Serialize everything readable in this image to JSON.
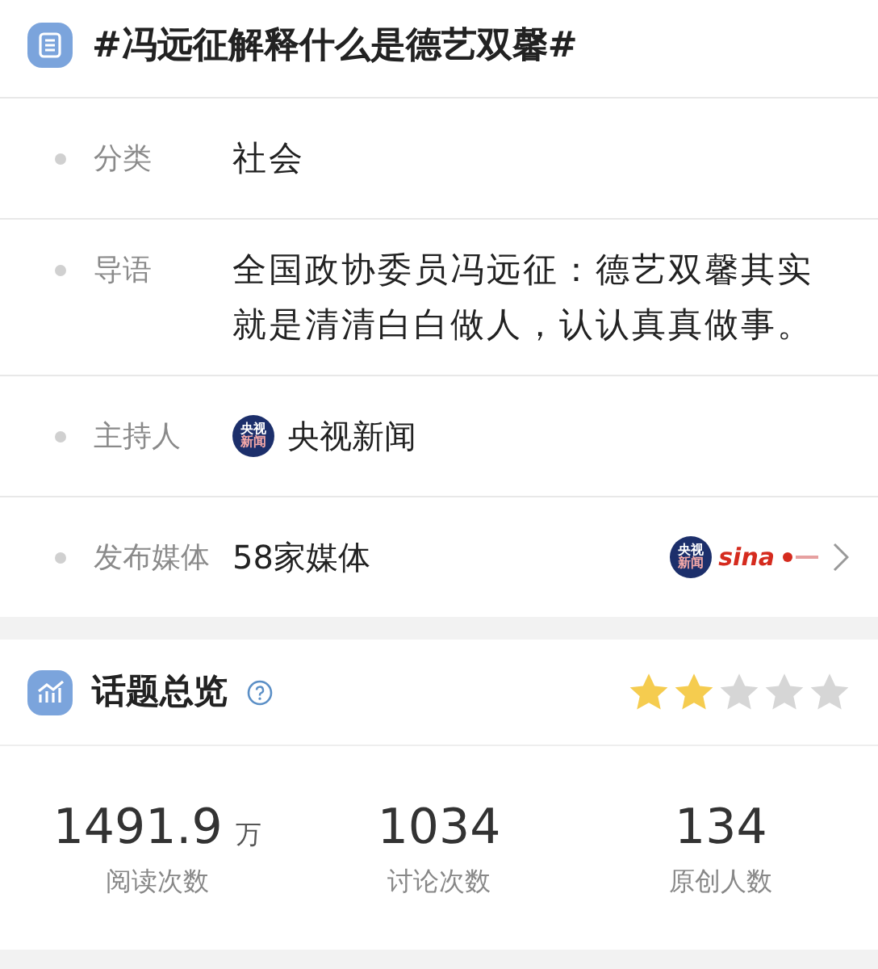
{
  "topic": {
    "title": "#冯远征解释什么是德艺双馨#"
  },
  "details": [
    {
      "kind": "text",
      "label": "分类",
      "value": "社会"
    },
    {
      "kind": "text",
      "label": "导语",
      "value": "全国政协委员冯远征：德艺双馨其实就是清清白白做人，认认真真做事。"
    },
    {
      "kind": "host",
      "label": "主持人",
      "logo_text": [
        "央视",
        "新闻"
      ],
      "value": "央视新闻"
    },
    {
      "kind": "media",
      "label": "发布媒体",
      "value": "58家媒体",
      "logo_text": [
        "央视",
        "新闻"
      ],
      "brand_text": "sina"
    }
  ],
  "overview": {
    "title": "话题总览",
    "stars": 2,
    "stats": [
      {
        "value": "1491.9",
        "unit": "万",
        "label": "阅读次数"
      },
      {
        "value": "1034",
        "label": "讨论次数"
      },
      {
        "value": "134",
        "label": "原创人数"
      }
    ]
  }
}
